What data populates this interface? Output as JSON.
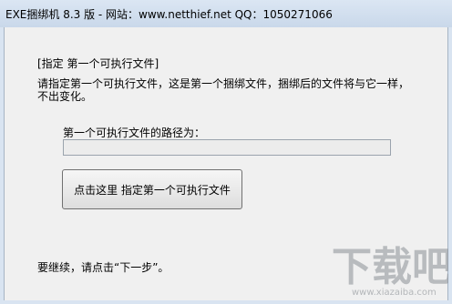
{
  "window": {
    "title": "EXE捆绑机 8.3 版 - 网站：www.netthief.net QQ：1050271066"
  },
  "wizard": {
    "section_header": "[指定 第一个可执行文件]",
    "description_line1": "请指定第一个可执行文件，这是第一个捆绑文件，捆绑后的文件将与它一样，",
    "description_line2": "不出变化。",
    "path_label": "第一个可执行文件的路径为：",
    "path_value": "",
    "choose_button": "点击这里 指定第一个可执行文件",
    "continue_hint": "要继续，请点击“下一步”。"
  },
  "watermark": {
    "text": "下载吧",
    "url": "www.xiazaiba.com"
  }
}
